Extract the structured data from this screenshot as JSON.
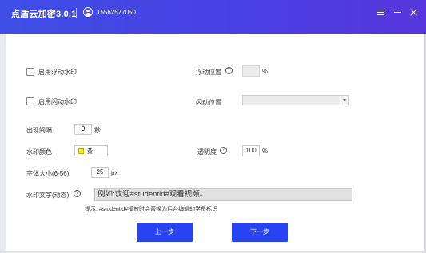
{
  "titlebar": {
    "app_title": "点盾云加密3.0.1",
    "phone": "15562577050"
  },
  "icons": [
    "user-icon",
    "menu-icon",
    "minimize-icon",
    "close-icon",
    "help-icon",
    "dropdown-arrow-icon"
  ],
  "settings": {
    "float_watermark_label": "启用浮动水印",
    "float_position_label": "浮动位置",
    "float_position_value": "",
    "float_position_unit": "%",
    "flash_watermark_label": "启用闪动水印",
    "flash_position_label": "闪动位置",
    "flash_position_value": "",
    "interval_label": "出现间隔",
    "interval_value": "0",
    "interval_unit": "秒",
    "color_label": "水印颜色",
    "color_value": "黄",
    "color_hex": "#f6ee2b",
    "opacity_label": "透明度",
    "opacity_value": "100",
    "opacity_unit": "%",
    "font_size_label": "字体大小(6-56)",
    "font_size_value": "25",
    "font_size_unit": "px",
    "text_label": "水印文字(动态)",
    "text_value": "例如:欢迎#studentid#观看视频。",
    "hint": "提示: #studentid#播放时会替换为后台编辑的学员标识"
  },
  "buttons": {
    "prev": "上一步",
    "next": "下一步"
  },
  "colors": {
    "titlebar_start": "#3f4ee6",
    "titlebar_end": "#5636dc",
    "button": "#2743f2"
  }
}
